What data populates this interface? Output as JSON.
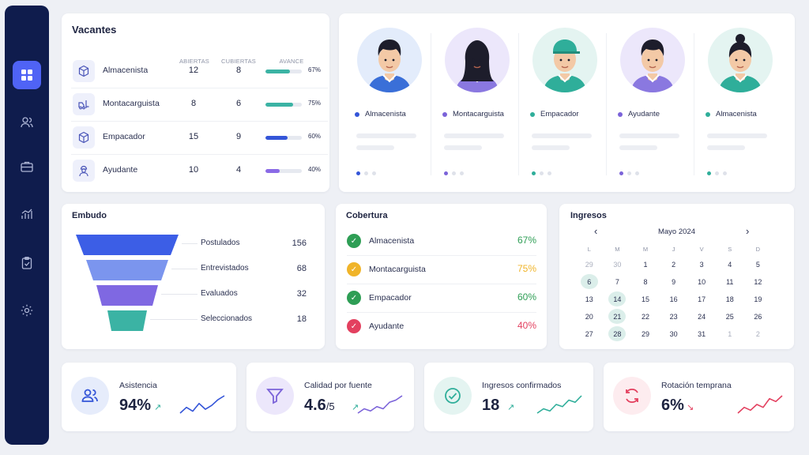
{
  "sidebar": {
    "items": [
      "dashboard-icon",
      "users-icon",
      "briefcase-icon",
      "chart-icon",
      "clipboard-icon",
      "gear-icon"
    ]
  },
  "vacantes": {
    "title": "Vacantes",
    "headers": {
      "abiertas": "ABIERTAS",
      "cubiertas": "CUBIERTAS",
      "avance": "AVANCE"
    },
    "rows": [
      {
        "label": "Almacenista",
        "abiertas": "12",
        "cubiertas": "8",
        "avance": "67%",
        "progress": 0.67,
        "color": "#3bb3a4",
        "icon": "box-icon"
      },
      {
        "label": "Montacarguista",
        "abiertas": "8",
        "cubiertas": "6",
        "avance": "75%",
        "progress": 0.75,
        "color": "#3bb3a4",
        "icon": "forklift-icon"
      },
      {
        "label": "Empacador",
        "abiertas": "15",
        "cubiertas": "9",
        "avance": "60%",
        "progress": 0.6,
        "color": "#3455d8",
        "icon": "box-icon"
      },
      {
        "label": "Ayudante",
        "abiertas": "10",
        "cubiertas": "4",
        "avance": "40%",
        "progress": 0.4,
        "color": "#8a6ae6",
        "icon": "worker-icon"
      }
    ]
  },
  "people": [
    {
      "role": "Almacenista",
      "dot": "#3455d8",
      "bg": "#e3ecfb",
      "shirt": "#3a6fd8",
      "hair": "#1d1d2b",
      "skin": "#f3c9a6"
    },
    {
      "role": "Montacarguista",
      "dot": "#7b63d9",
      "bg": "#ece7fb",
      "shirt": "#8a78e0",
      "hair": "#1d1d2b",
      "skin": "#f3c9a6"
    },
    {
      "role": "Empacador",
      "dot": "#2fae9a",
      "bg": "#e4f4f1",
      "shirt": "#2fae9a",
      "hair": "#1d1d2b",
      "skin": "#f3c9a6"
    },
    {
      "role": "Ayudante",
      "dot": "#7b63d9",
      "bg": "#ece7fb",
      "shirt": "#8a78e0",
      "hair": "#1d1d2b",
      "skin": "#f3c9a6"
    },
    {
      "role": "Almacenista",
      "dot": "#2fae9a",
      "bg": "#e4f4f1",
      "shirt": "#2fae9a",
      "hair": "#1d1d2b",
      "skin": "#f3c9a6"
    }
  ],
  "embudo": {
    "title": "Embudo",
    "stages": [
      {
        "label": "Postulados",
        "value": "156",
        "color": "#3c5ee6"
      },
      {
        "label": "Entrevistados",
        "value": "68",
        "color": "#7b95ee"
      },
      {
        "label": "Evaluados",
        "value": "32",
        "color": "#7f68e2"
      },
      {
        "label": "Seleccionados",
        "value": "18",
        "color": "#3bb3a4"
      }
    ]
  },
  "cobertura": {
    "title": "Cobertura",
    "rows": [
      {
        "label": "Almacenista",
        "value": "67%",
        "color": "#2e9e55"
      },
      {
        "label": "Montacarguista",
        "value": "75%",
        "color": "#f0b429"
      },
      {
        "label": "Empacador",
        "value": "60%",
        "color": "#2e9e55"
      },
      {
        "label": "Ayudante",
        "value": "40%",
        "color": "#e3405f"
      }
    ]
  },
  "ingresos": {
    "title": "Ingresos",
    "month": "Mayo 2024",
    "prev": "‹",
    "next": "›",
    "weekdays": [
      "L",
      "M",
      "M",
      "J",
      "V",
      "S",
      "D"
    ],
    "days": [
      "29",
      "30",
      "1",
      "2",
      "3",
      "4",
      "5",
      "6",
      "7",
      "8",
      "9",
      "10",
      "11",
      "12",
      "13",
      "14",
      "15",
      "16",
      "17",
      "18",
      "19",
      "20",
      "21",
      "22",
      "23",
      "24",
      "25",
      "26",
      "27",
      "28",
      "29",
      "30",
      "31",
      "1",
      "2"
    ],
    "outside": [
      0,
      1,
      33,
      34
    ],
    "highlight": [
      7,
      15,
      22,
      29
    ]
  },
  "kpis": [
    {
      "label": "Asistencia",
      "value": "94%",
      "suffix": "",
      "arrow": "↗",
      "arrow_color": "#2fae9a",
      "icon_bg": "#e6ecfb",
      "icon_color": "#3455d8",
      "icon": "users-icon",
      "spark": "#3455d8",
      "trend": [
        3,
        6,
        4,
        8,
        5,
        7,
        10,
        12
      ]
    },
    {
      "label": "Calidad por fuente",
      "value": "4.6",
      "suffix": "/5",
      "arrow": "↗",
      "arrow_color": "#2fae9a",
      "icon_bg": "#ece7fb",
      "icon_color": "#7b63d9",
      "icon": "filter-icon",
      "spark": "#7b63d9",
      "trend": [
        3,
        5,
        4,
        6,
        5,
        8,
        9,
        11
      ]
    },
    {
      "label": "Ingresos confirmados",
      "value": "18",
      "suffix": "",
      "arrow": "↗",
      "arrow_color": "#2fae9a",
      "icon_bg": "#e4f4f1",
      "icon_color": "#2fae9a",
      "icon": "check-circle-icon",
      "spark": "#2fae9a",
      "trend": [
        3,
        5,
        4,
        7,
        6,
        9,
        8,
        11
      ]
    },
    {
      "label": "Rotación temprana",
      "value": "6%",
      "suffix": "",
      "arrow": "↘",
      "arrow_color": "#e3405f",
      "icon_bg": "#fdecef",
      "icon_color": "#e3405f",
      "icon": "refresh-icon",
      "spark": "#e3405f",
      "trend": [
        4,
        6,
        5,
        7,
        6,
        9,
        8,
        10
      ]
    }
  ]
}
